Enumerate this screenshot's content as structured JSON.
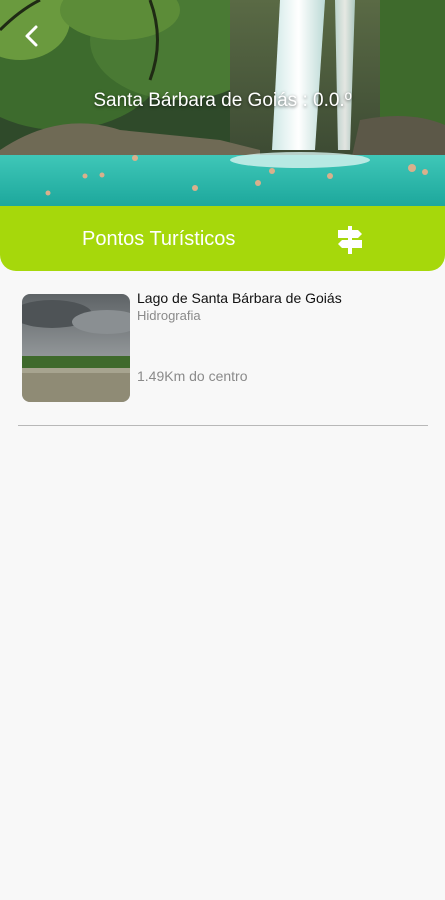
{
  "header": {
    "title": "Santa Bárbara de Goiás : 0.0.º",
    "back_icon": "chevron-left-icon"
  },
  "section": {
    "title": "Pontos Turísticos",
    "icon": "signpost-icon",
    "color": "#a6d80b"
  },
  "list": {
    "items": [
      {
        "name": "Lago de Santa Bárbara de Goiás",
        "category": "Hidrografia",
        "distance": "1.49Km do centro"
      }
    ]
  }
}
